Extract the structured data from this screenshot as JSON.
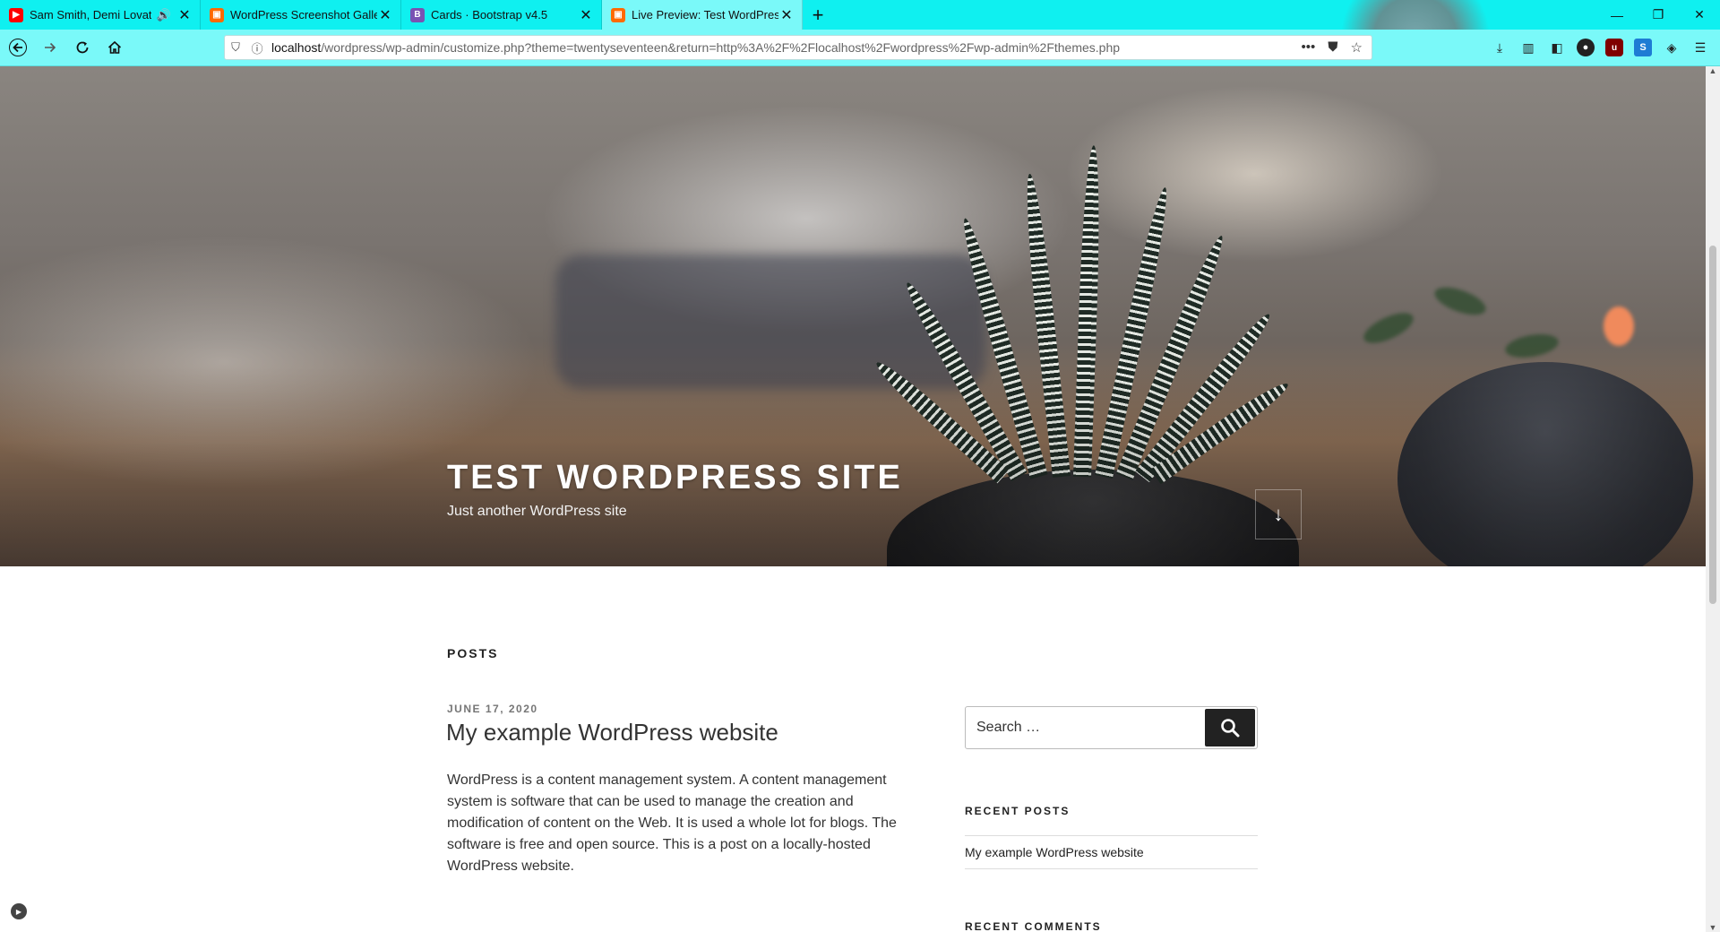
{
  "browser": {
    "tabs": [
      {
        "label": "Sam Smith, Demi Lovato - I'm Ready",
        "active": false,
        "audio": true,
        "favicon": "youtube-icon",
        "favicon_color": "#ff0000"
      },
      {
        "label": "WordPress Screenshot Gallery",
        "active": false,
        "audio": false,
        "favicon": "screenshot-icon",
        "favicon_color": "#ff6a00"
      },
      {
        "label": "Cards · Bootstrap v4.5",
        "active": false,
        "audio": false,
        "favicon": "bootstrap-icon",
        "favicon_color": "#7952b3"
      },
      {
        "label": "Live Preview: Test WordPress Site",
        "active": true,
        "audio": false,
        "favicon": "screenshot-icon",
        "favicon_color": "#ff6a00"
      }
    ],
    "new_tab_glyph": "+",
    "url": {
      "host": "localhost",
      "path": "/wordpress/wp-admin/customize.php?theme=twentyseventeen&return=http%3A%2F%2Flocalhost%2Fwordpress%2Fwp-admin%2Fthemes.php"
    },
    "accent_color": "#0ff0f0"
  },
  "site": {
    "title": "TEST WORDPRESS SITE",
    "tagline": "Just another WordPress site"
  },
  "main": {
    "section_title": "POSTS",
    "posts": [
      {
        "date": "JUNE 17, 2020",
        "title": "My example WordPress website",
        "excerpt": "WordPress is a content management system. A content management system is software that can be used to manage the creation and modification of content on the Web. It is used a whole lot for blogs. The software is free and open source. This is a post on a locally-hosted WordPress website."
      }
    ]
  },
  "sidebar": {
    "search_placeholder": "Search …",
    "recent_posts_title": "RECENT POSTS",
    "recent_posts": [
      "My example WordPress website"
    ],
    "recent_comments_title": "RECENT COMMENTS"
  }
}
